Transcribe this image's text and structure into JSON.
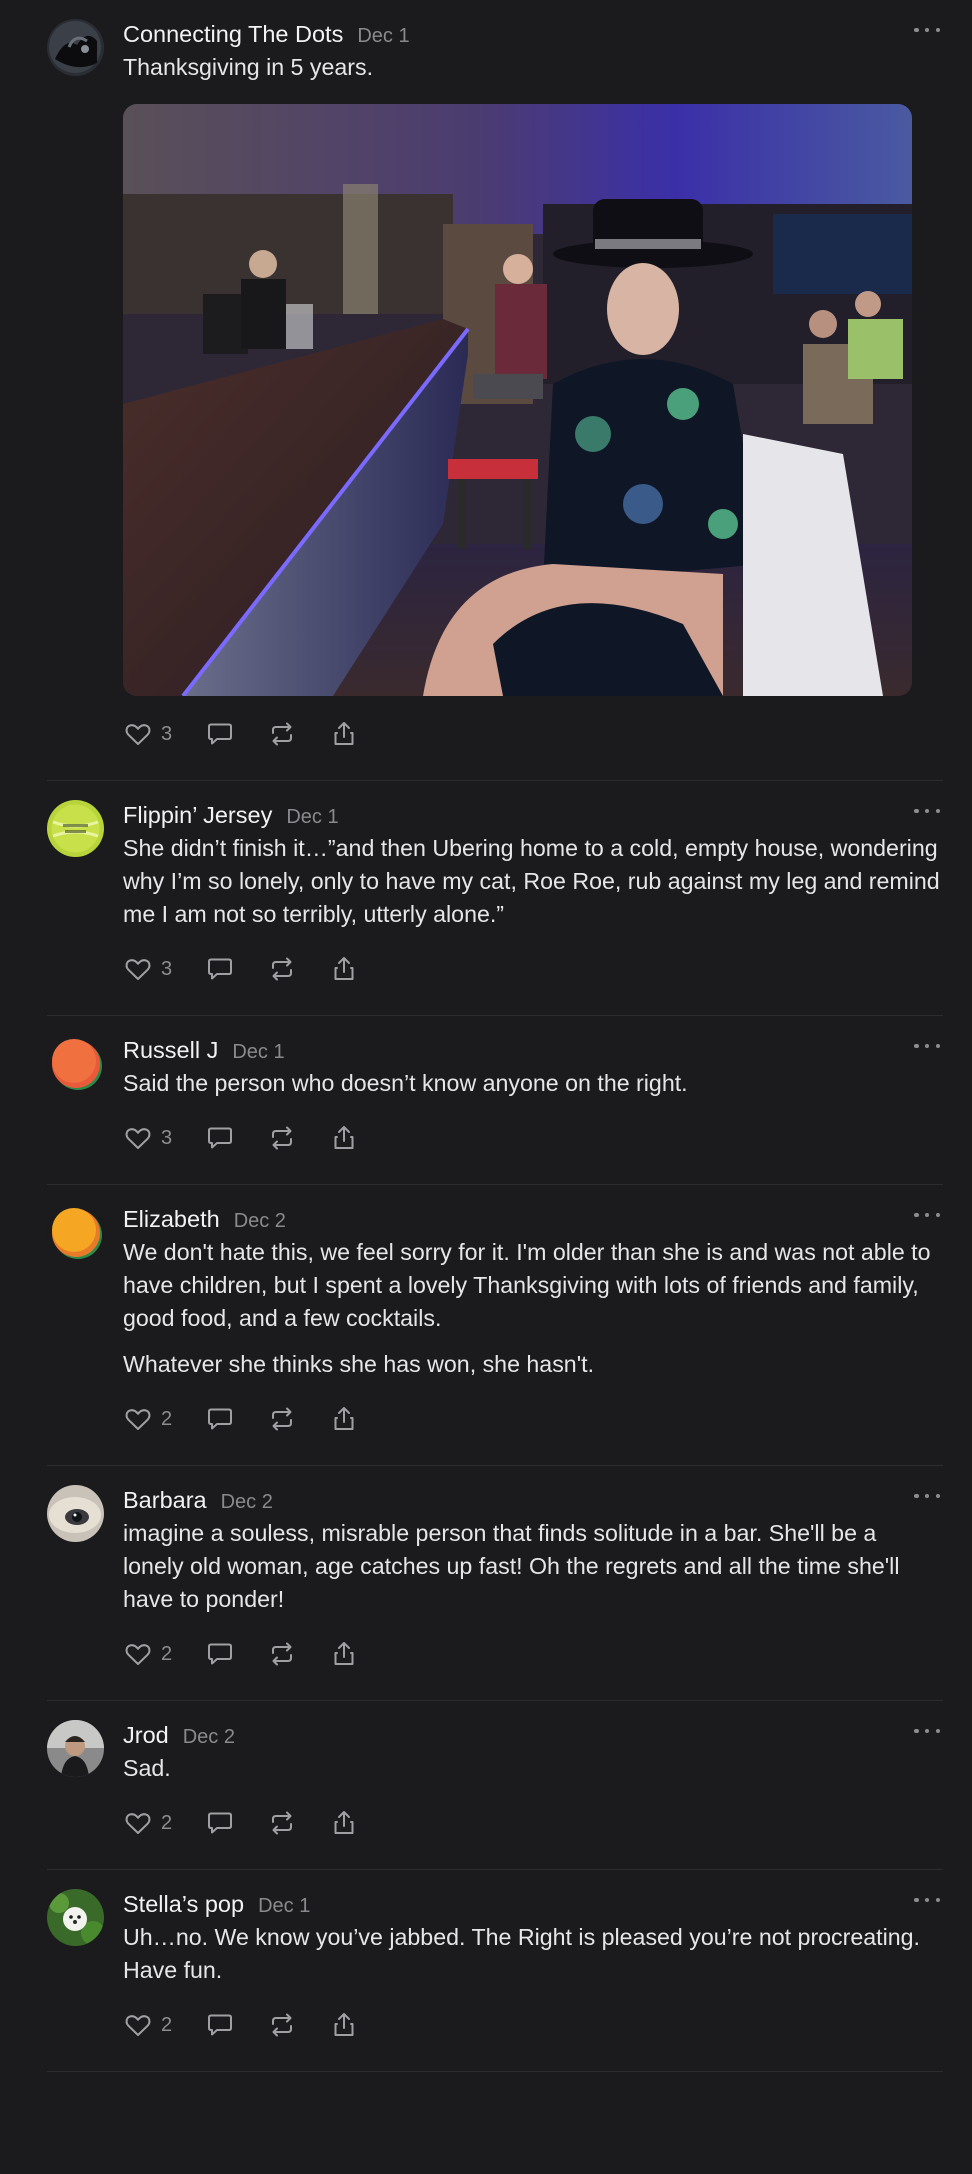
{
  "colors": {
    "background": "#1b1b1d",
    "text": "#e6e6e8",
    "muted": "#8d8d91",
    "divider": "#2c2c2f"
  },
  "icons": {
    "like": "heart-icon",
    "reply": "comment-icon",
    "repost": "repost-icon",
    "share": "share-icon",
    "menu": "ellipsis-icon"
  },
  "posts": [
    {
      "author": "Connecting The Dots",
      "date": "Dec 1",
      "text": [
        "Thanksgiving in 5 years."
      ],
      "likes": "3",
      "has_image": true
    },
    {
      "author": "Flippin’ Jersey",
      "date": "Dec 1",
      "text": [
        "She didn’t finish it…”and then Ubering home to a cold, empty house, wondering why I’m so lonely, only to have my cat, Roe Roe, rub against my leg and remind me I am not so terribly, utterly alone.”"
      ],
      "likes": "3"
    },
    {
      "author": "Russell J",
      "date": "Dec 1",
      "text": [
        "Said the person who doesn’t know anyone on the right."
      ],
      "likes": "3"
    },
    {
      "author": "Elizabeth",
      "date": "Dec 2",
      "text": [
        "We don't hate this, we feel sorry for it. I'm older than she is and was not able to have children, but I spent a lovely Thanksgiving with lots of friends and family, good food, and a few cocktails.",
        "Whatever she thinks she has won, she hasn't."
      ],
      "likes": "2"
    },
    {
      "author": "Barbara",
      "date": "Dec 2",
      "text": [
        "imagine a souless, misrable person that finds solitude in a bar. She'll be a lonely old woman, age catches up fast! Oh the regrets and all the time she'll have to ponder!"
      ],
      "likes": "2"
    },
    {
      "author": "Jrod",
      "date": "Dec 2",
      "text": [
        "Sad."
      ],
      "likes": "2"
    },
    {
      "author": "Stella’s pop",
      "date": "Dec 1",
      "text": [
        "Uh…no. We know you’ve jabbed. The Right is pleased you’re not procreating. Have fun."
      ],
      "likes": "2"
    }
  ]
}
